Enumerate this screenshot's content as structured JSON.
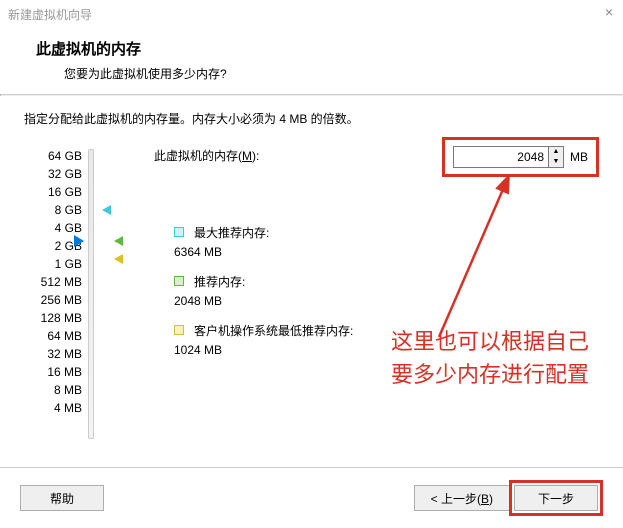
{
  "window": {
    "title": "新建虚拟机向导",
    "close_icon": "×"
  },
  "header": {
    "title": "此虚拟机的内存",
    "subtitle": "您要为此虚拟机使用多少内存?"
  },
  "instruction": "指定分配给此虚拟机的内存量。内存大小必须为 4 MB 的倍数。",
  "scale": {
    "labels": [
      "64 GB",
      "32 GB",
      "16 GB",
      "8 GB",
      "4 GB",
      "2 GB",
      "1 GB",
      "512 MB",
      "256 MB",
      "128 MB",
      "64 MB",
      "32 MB",
      "16 MB",
      "8 MB",
      "4 MB"
    ]
  },
  "memory": {
    "label_prefix": "此虚拟机的内存(",
    "label_key": "M",
    "label_suffix": "):",
    "value": "2048",
    "unit": "MB"
  },
  "legend": {
    "max": {
      "label": "最大推荐内存:",
      "value": "6364 MB"
    },
    "recommended": {
      "label": "推荐内存:",
      "value": "2048 MB"
    },
    "guest_min": {
      "label": "客户机操作系统最低推荐内存:",
      "value": "1024 MB"
    }
  },
  "annotation": {
    "text": "这里也可以根据自己要多少内存进行配置"
  },
  "footer": {
    "help": "帮助",
    "back_prefix": "< 上一步(",
    "back_key": "B",
    "back_suffix": ")",
    "next_prefix": "下一步",
    "next_key": "",
    "next_suffix": ""
  }
}
